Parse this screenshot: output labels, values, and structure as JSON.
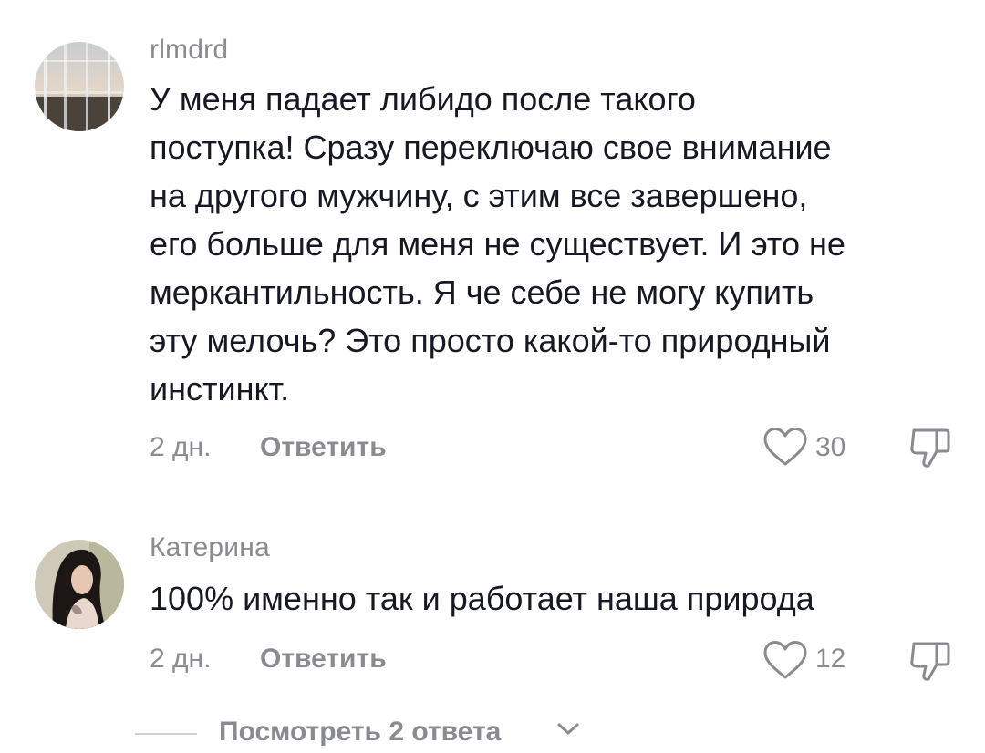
{
  "comments": [
    {
      "username": "rlmdrd",
      "text": "У меня падает либидо после такого\nпоступка! Сразу переключаю свое внимание\nна другого мужчину, с этим все завершено,\nего больше для меня не существует. И это не\nмеркантильность. Я че себе не могу купить\nэту мелочь? Это просто какой-то природный\nинстинкт.",
      "time": "2 дн.",
      "reply_label": "Ответить",
      "likes": "30"
    },
    {
      "username": "Катерина",
      "text": "100% именно так и работает наша природа",
      "time": "2 дн.",
      "reply_label": "Ответить",
      "likes": "12"
    }
  ],
  "view_replies": {
    "label": "Посмотреть 2 ответа"
  },
  "icons": {
    "like": "heart-outline-icon",
    "dislike": "thumbs-down-outline-icon",
    "expand": "chevron-down-icon"
  },
  "colors": {
    "text": "#161823",
    "secondary": "#8a8b91",
    "divider": "#d0d1d3"
  }
}
